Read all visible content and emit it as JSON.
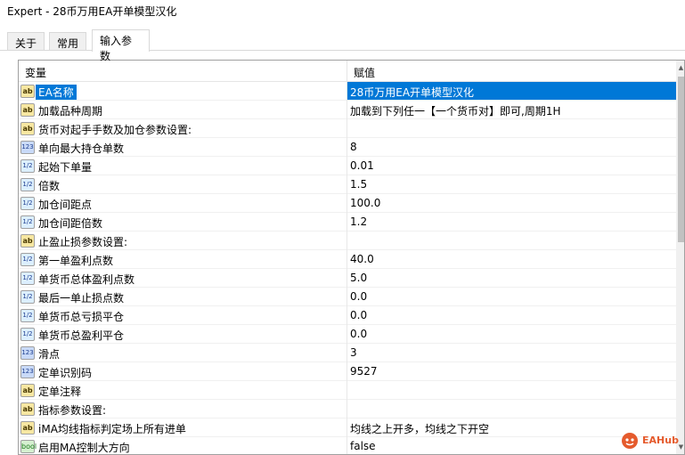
{
  "window": {
    "title": "Expert - 28币万用EA开单模型汉化"
  },
  "tabs": [
    {
      "label": "关于",
      "active": false
    },
    {
      "label": "常用",
      "active": false
    },
    {
      "label": "输入参数",
      "active": true
    }
  ],
  "grid": {
    "header": {
      "name": "变量",
      "value": "赋值"
    },
    "rows": [
      {
        "type": "ab",
        "name": "EA名称",
        "value": "28币万用EA开单模型汉化",
        "selected": true
      },
      {
        "type": "ab",
        "name": "加载品种周期",
        "value": "加载到下列任一【一个货币对】即可,周期1H"
      },
      {
        "type": "ab",
        "name": "货币对起手手数及加仓参数设置:",
        "value": ""
      },
      {
        "type": "123",
        "name": "单向最大持仓单数",
        "value": "8"
      },
      {
        "type": "1/2",
        "name": "起始下单量",
        "value": "0.01"
      },
      {
        "type": "1/2",
        "name": "倍数",
        "value": "1.5"
      },
      {
        "type": "1/2",
        "name": "加仓间距点",
        "value": "100.0"
      },
      {
        "type": "1/2",
        "name": "加仓间距倍数",
        "value": "1.2"
      },
      {
        "type": "ab",
        "name": "止盈止损参数设置:",
        "value": ""
      },
      {
        "type": "1/2",
        "name": "第一单盈利点数",
        "value": "40.0"
      },
      {
        "type": "1/2",
        "name": "单货币总体盈利点数",
        "value": "5.0"
      },
      {
        "type": "1/2",
        "name": "最后一单止损点数",
        "value": "0.0"
      },
      {
        "type": "1/2",
        "name": "单货币总亏损平仓",
        "value": "0.0"
      },
      {
        "type": "1/2",
        "name": "单货币总盈利平仓",
        "value": "0.0"
      },
      {
        "type": "123",
        "name": "滑点",
        "value": "3"
      },
      {
        "type": "123",
        "name": "定单识别码",
        "value": "9527"
      },
      {
        "type": "ab",
        "name": "定单注释",
        "value": ""
      },
      {
        "type": "ab",
        "name": "指标参数设置:",
        "value": ""
      },
      {
        "type": "ab",
        "name": "iMA均线指标判定场上所有进单",
        "value": "均线之上开多，均线之下开空"
      },
      {
        "type": "bool",
        "name": "启用MA控制大方向",
        "value": "false"
      }
    ]
  },
  "watermark": {
    "text": "EAHub"
  },
  "colors": {
    "selection": "#0078d7",
    "watermark": "#e55b2d"
  },
  "icons": {
    "ab": "string-type-icon",
    "123": "integer-type-icon",
    "1/2": "double-type-icon",
    "bool": "bool-type-icon"
  }
}
